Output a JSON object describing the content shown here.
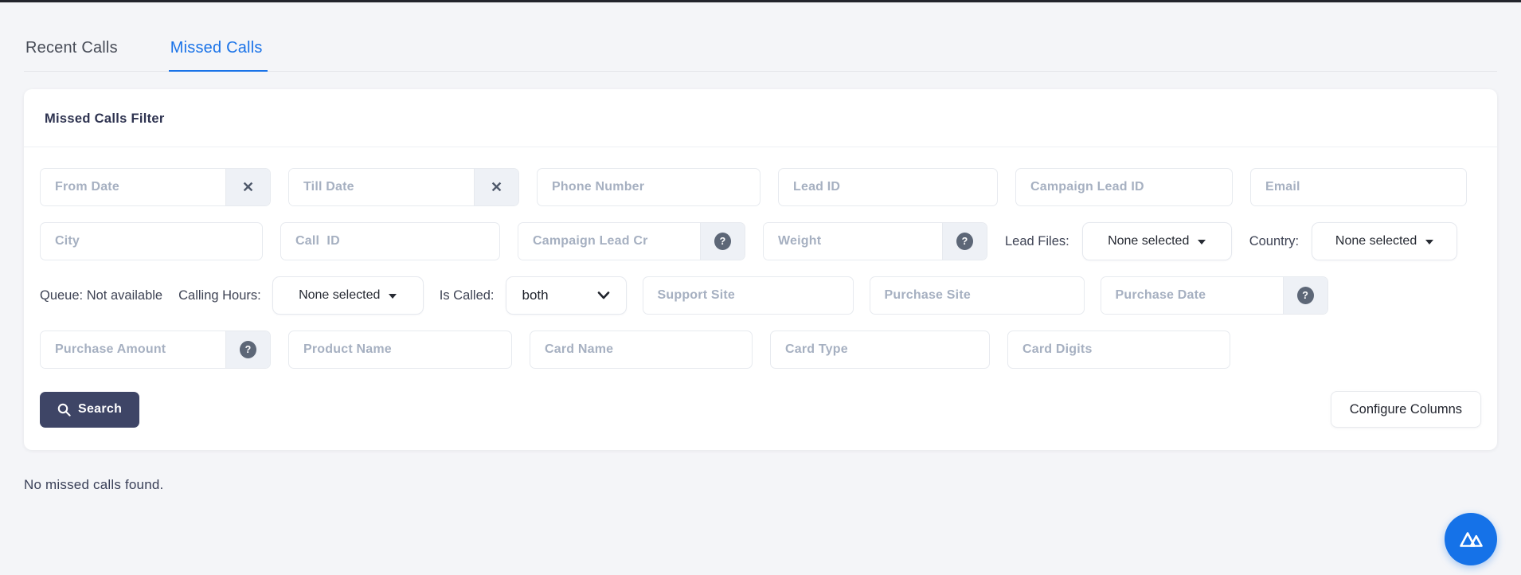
{
  "tabs": {
    "recent_calls": "Recent Calls",
    "missed_calls": "Missed Calls"
  },
  "filter": {
    "title": "Missed Calls Filter",
    "placeholders": {
      "from_date": "From Date",
      "till_date": "Till Date",
      "phone_number": "Phone Number",
      "lead_id": "Lead ID",
      "campaign_lead_id": "Campaign Lead ID",
      "email": "Email",
      "city": "City",
      "call_id": "Call  ID",
      "campaign_lead_cr": "Campaign Lead Cr",
      "weight": "Weight",
      "support_site": "Support Site",
      "purchase_site": "Purchase Site",
      "purchase_date": "Purchase Date",
      "purchase_amount": "Purchase Amount",
      "product_name": "Product Name",
      "card_name": "Card Name",
      "card_type": "Card Type",
      "card_digits": "Card Digits"
    },
    "labels": {
      "queue": "Queue: Not available",
      "calling_hours": "Calling Hours:",
      "is_called": "Is Called:",
      "lead_files": "Lead Files:",
      "country": "Country:"
    },
    "selects": {
      "lead_files": "None selected",
      "country": "None selected",
      "calling_hours": "None selected",
      "is_called": "both"
    },
    "buttons": {
      "search": "Search",
      "configure_columns": "Configure Columns"
    },
    "icons": {
      "clear": "✕",
      "help": "?"
    }
  },
  "results": {
    "empty_message": "No missed calls found."
  },
  "colors": {
    "accent_blue": "#1a73e8",
    "search_button_bg": "#3e4566",
    "fab_bg": "#1572e8",
    "placeholder": "#a6b0c1"
  }
}
